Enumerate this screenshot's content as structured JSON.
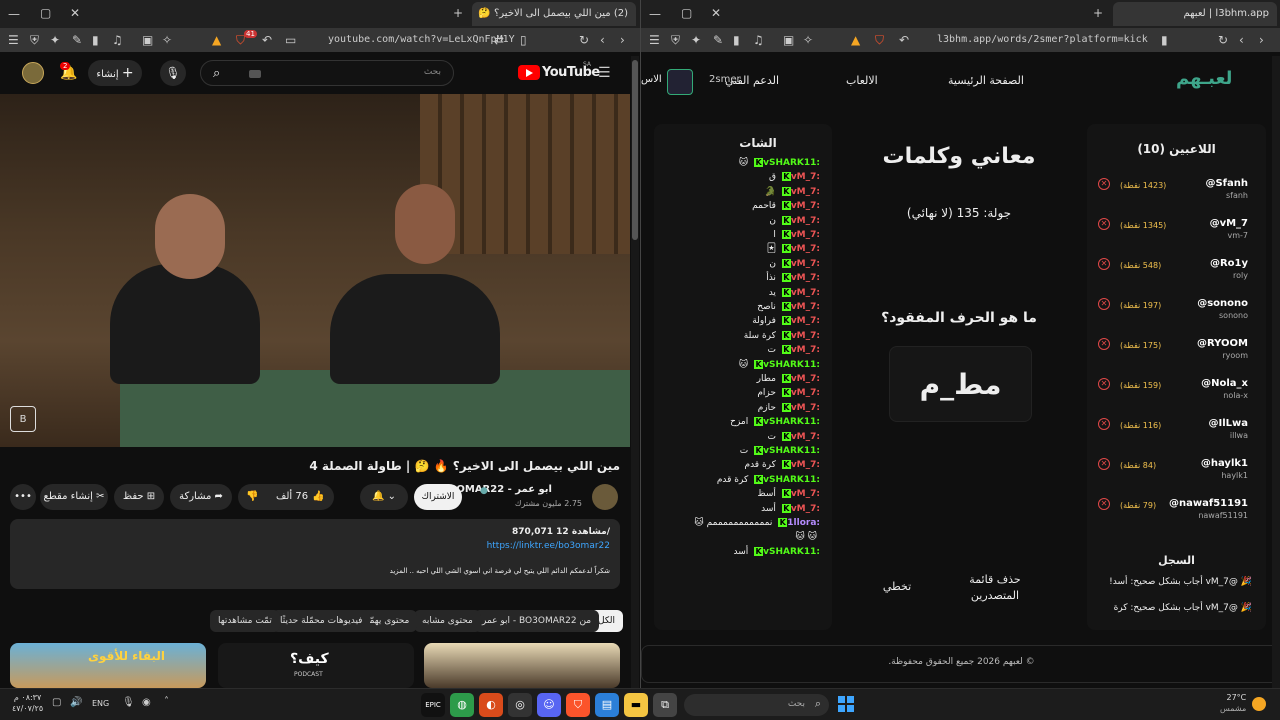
{
  "left_window": {
    "tab_title": "(2) مين اللي بيصمل الى الاخير؟ 🤔",
    "url": "youtube.com/watch?v=LeLxQnFpM1Y",
    "notif_badge": "2",
    "ext_badge": "41",
    "youtube": {
      "logo": "YouTube",
      "region": "SA",
      "search_placeholder": "بحث",
      "create_label": "إنشاء",
      "video_title": "مين اللي بيصمل الى الاخير؟ 🔥 🤔 | طاولة الصملة 4",
      "channel_name": "BO3OMAR22 - ابو عمر",
      "subscribers": "2.75 مليون مشترك",
      "subscribe_label": "الاشتراك",
      "likes": "76 ألف",
      "share_label": "مشاركة",
      "save_label": "حفظ",
      "clip_label": "إنشاء مقطع",
      "desc_stats": "870,071 مشاهدة 12/",
      "desc_link": "https://linktr.ee/bo3omar22",
      "desc_text": "شكراً لدعمكم الدائم اللي يتيح لي فرصة اني اسوي الشي اللي احبه .. المزيد",
      "chips": [
        "الكل",
        "من BO3OMAR22 - ابو عمر",
        "محتوى مشابه",
        "محتوى يهمّك",
        "فيديوهات محمّلة حديثًا",
        "تمّت مشاهدتها"
      ],
      "thumb_texts": [
        "البقاء للأقوى",
        "كيف؟",
        "PODCAST"
      ]
    }
  },
  "right_window": {
    "tab_title": "l3bhm.app | لعبهم",
    "url": "l3bhm.app/words/2smer?platform=kick",
    "site": {
      "logo": "لعبـهم",
      "nav": [
        "الصفحة الرئيسية",
        "الالعاب",
        "الدعم الفني"
      ],
      "user_label": "2smer",
      "nav_cut": "الاس",
      "players_title": "اللاعبين (10)",
      "players": [
        {
          "name": "@Sfanh",
          "user": "sfanh",
          "points": "(1423 نقطة)"
        },
        {
          "name": "@vM_7",
          "user": "vm-7",
          "points": "(1345 نقطة)"
        },
        {
          "name": "@Ro1y",
          "user": "roly",
          "points": "(548 نقطة)"
        },
        {
          "name": "@sonono",
          "user": "sonono",
          "points": "(197 نقطة)"
        },
        {
          "name": "@RYOOM",
          "user": "ryoom",
          "points": "(175 نقطة)"
        },
        {
          "name": "@Nola_x",
          "user": "nola-x",
          "points": "(159 نقطة)"
        },
        {
          "name": "@IlLwa",
          "user": "illwa",
          "points": "(116 نقطة)"
        },
        {
          "name": "@haylk1",
          "user": "haylk1",
          "points": "(84 نقطة)"
        },
        {
          "name": "@nawaf51191",
          "user": "nawaf51191",
          "points": "(79 نقطة)"
        }
      ],
      "log_title": "السجل",
      "log_entries": [
        "@vM_7 أجاب بشكل صحيح: أسد!",
        "@vM_7 أجاب بشكل صحيح: كرة"
      ],
      "game_title": "معاني وكلمات",
      "round": "جولة: 135 (لا نهائي)",
      "question": "ما هو الحرف المفقود؟",
      "word": "مط_م",
      "btn_clear": "حذف قائمة المتصدرين",
      "btn_skip": "تخطي",
      "chat_title": "الشات",
      "chat": [
        {
          "user": "vSHARK11:",
          "msg": "🐱",
          "color": "#53fc18"
        },
        {
          "user": "vM_7:",
          "msg": "ق",
          "color": "#e55"
        },
        {
          "user": "vM_7:",
          "msg": "🐊",
          "color": "#e55"
        },
        {
          "user": "vM_7:",
          "msg": "قاحمم",
          "color": "#e55"
        },
        {
          "user": "vM_7:",
          "msg": "ن",
          "color": "#e55"
        },
        {
          "user": "vM_7:",
          "msg": "ا",
          "color": "#e55"
        },
        {
          "user": "vM_7:",
          "msg": "🃏",
          "color": "#e55"
        },
        {
          "user": "vM_7:",
          "msg": "ن",
          "color": "#e55"
        },
        {
          "user": "vM_7:",
          "msg": "نذأ",
          "color": "#e55"
        },
        {
          "user": "vM_7:",
          "msg": "يد",
          "color": "#e55"
        },
        {
          "user": "vM_7:",
          "msg": "ناصح",
          "color": "#e55"
        },
        {
          "user": "vM_7:",
          "msg": "فراولة",
          "color": "#e55"
        },
        {
          "user": "vM_7:",
          "msg": "كرة سلة",
          "color": "#e55"
        },
        {
          "user": "vM_7:",
          "msg": "ت",
          "color": "#e55"
        },
        {
          "user": "vSHARK11:",
          "msg": "🐱",
          "color": "#53fc18"
        },
        {
          "user": "vM_7:",
          "msg": "مطار",
          "color": "#e55"
        },
        {
          "user": "vM_7:",
          "msg": "حزام",
          "color": "#e55"
        },
        {
          "user": "vM_7:",
          "msg": "حازم",
          "color": "#e55"
        },
        {
          "user": "vSHARK11:",
          "msg": "امزح",
          "color": "#53fc18"
        },
        {
          "user": "vM_7:",
          "msg": "ت",
          "color": "#e55"
        },
        {
          "user": "vSHARK11:",
          "msg": "ت",
          "color": "#53fc18"
        },
        {
          "user": "vM_7:",
          "msg": "كرة قدم",
          "color": "#e55"
        },
        {
          "user": "vSHARK11:",
          "msg": "كرة قدم",
          "color": "#53fc18"
        },
        {
          "user": "vM_7:",
          "msg": "أسظ",
          "color": "#e55"
        },
        {
          "user": "vM_7:",
          "msg": "أسد",
          "color": "#e55"
        },
        {
          "user": "1llora:",
          "msg": "نمممممممممممم 🐱",
          "color": "#b58cff"
        },
        {
          "user": "",
          "msg": "🐱 🐱",
          "color": "#b58cff"
        },
        {
          "user": "vSHARK11:",
          "msg": "أسد",
          "color": "#53fc18"
        }
      ],
      "footer": "© لعبهم 2026 جميع الحقوق محفوظة."
    }
  },
  "taskbar": {
    "search_placeholder": "بحث",
    "time": "٠٨:٣٧ م",
    "date": "٤٧/٠٧/٢٥",
    "lang": "ENG",
    "weather_temp": "27°C",
    "weather_desc": "مشمس"
  },
  "colors": {
    "accent_green": "#53fc18",
    "youtube_red": "#ff0000",
    "brave_orange": "#fb542b"
  }
}
